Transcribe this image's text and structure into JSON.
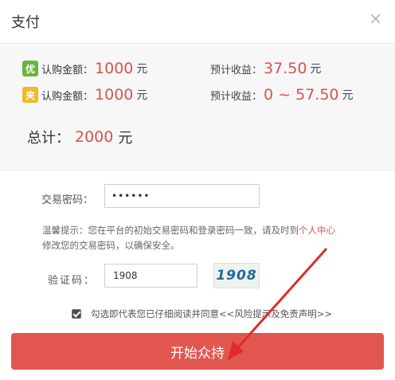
{
  "dialog": {
    "title": "支付",
    "close_glyph": "×"
  },
  "summary": {
    "rows": [
      {
        "badge": "优",
        "badge_color": "#6cb33f",
        "label": "认购金额：",
        "amount": "1000",
        "unit": "元",
        "profit_label": "预计收益：",
        "profit_value": "37.50",
        "profit_unit": "元"
      },
      {
        "badge": "夹",
        "badge_color": "#f1b82a",
        "label": "认购金额：",
        "amount": "1000",
        "unit": "元",
        "profit_label": "预计收益：",
        "profit_value": "0 ~ 57.50",
        "profit_unit": "元"
      }
    ],
    "total_label": "总计：",
    "total_value": "2000",
    "total_unit": "元"
  },
  "form": {
    "password_label": "交易密码：",
    "password_value": "••••••",
    "tip_text": "温馨提示：您在平台的初始交易密码和登录密码一致，请及时到",
    "tip_link": "个人中心",
    "tip_text2": "修改您的交易密码，以确保安全。",
    "code_label": "验证码：",
    "code_value": "1908",
    "captcha_text": "1908",
    "agree_text": "勾选即代表您已仔细阅读并同意",
    "agree_link": "<<风险提示及免责声明>>",
    "agree_checked": true
  },
  "submit_label": "开始众持",
  "colors": {
    "accent": "#e25650",
    "amount": "#d9534f"
  }
}
